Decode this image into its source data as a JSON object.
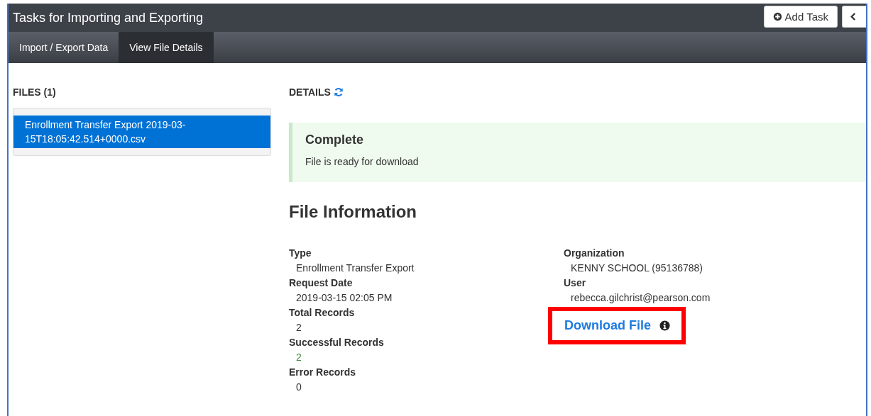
{
  "header": {
    "title": "Tasks for Importing and Exporting",
    "buttons": [
      {
        "label": "Add Task",
        "kind": "add"
      },
      {
        "kind": "back"
      }
    ]
  },
  "tabs": [
    {
      "label": "Import / Export Data",
      "selected": false
    },
    {
      "label": "View File Details",
      "selected": true
    }
  ],
  "files": {
    "heading": "FILES (1)",
    "items": [
      {
        "name": "Enrollment Transfer Export 2019-03-15T18:05:42.514+0000.csv",
        "selected": true
      }
    ]
  },
  "details": {
    "heading": "DETAILS",
    "status": {
      "title": "Complete",
      "message": "File is ready for download"
    },
    "info_heading": "File Information",
    "left_fields": [
      {
        "label": "Type",
        "value": "Enrollment Transfer Export",
        "color": "#333333"
      },
      {
        "label": "Request Date",
        "value": "2019-03-15 02:05 PM",
        "color": "#333333"
      },
      {
        "label": "Total Records",
        "value": "2",
        "color": "#333333"
      },
      {
        "label": "Successful Records",
        "value": "2",
        "color": "#3c8a3c"
      },
      {
        "label": "Error Records",
        "value": "0",
        "color": "#333333"
      }
    ],
    "right_fields": [
      {
        "label": "Organization",
        "value": "KENNY SCHOOL (95136788)",
        "color": "#333333"
      },
      {
        "label": "User",
        "value": "rebecca.gilchrist@pearson.com",
        "color": "#333333"
      }
    ],
    "download_link": "Download File"
  }
}
